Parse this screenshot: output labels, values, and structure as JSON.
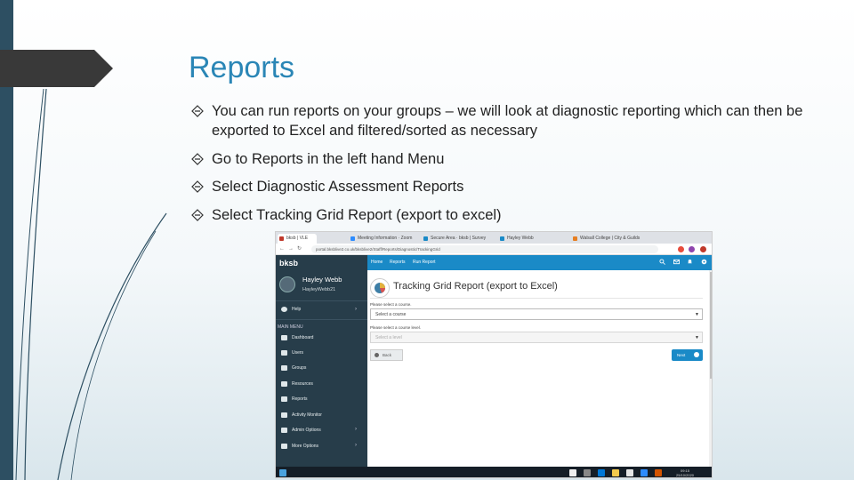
{
  "slide": {
    "title": "Reports",
    "bullets": [
      "You can run reports on your groups – we will look at diagnostic reporting which can then be exported to Excel and filtered/sorted as necessary",
      "Go to Reports in the left hand Menu",
      "Select Diagnostic Assessment Reports",
      "Select Tracking Grid Report (export to excel)"
    ],
    "colors": {
      "title": "#2a86b6",
      "left_bar": "#2d4f62",
      "title_tab": "#393939"
    }
  },
  "browser": {
    "tabs": [
      "bksb | VLE",
      "Meeting Information · Zoom",
      "Secure Area · bksb | Survey",
      "Hayley Webb",
      "Walsall College | City & Guilds"
    ],
    "url": "portal.bksblive2.co.uk/bksblive2/Staff/Reports/Diagnostic/TrackingGrid",
    "nav_icons": [
      "back-icon",
      "forward-icon",
      "reload-icon"
    ]
  },
  "app": {
    "brand": "bksb",
    "user_name": "Hayley Webb",
    "user_id": "HayleyWebb21",
    "help_label": "Help",
    "menu_heading": "MAIN MENU",
    "menu_items": [
      "Dashboard",
      "Users",
      "Groups",
      "Resources",
      "Reports",
      "Activity Monitor",
      "Admin Options",
      "More Options"
    ],
    "topbar_links": [
      "Home",
      "Reports",
      "Run Report"
    ],
    "topbar_icons": [
      "search-icon",
      "mail-icon",
      "bell-icon",
      "settings-icon"
    ],
    "accent": "#1a8ac7",
    "sidebar_color": "#273d4a"
  },
  "report_page": {
    "heading": "Tracking Grid Report (export to Excel)",
    "course_label": "Please select a course.",
    "course_value": "Select a course",
    "level_label": "Please select a course level.",
    "level_value": "Select a level",
    "back_label": "Back",
    "next_label": "Next"
  },
  "taskbar": {
    "time": "09:15",
    "date": "25/10/2020"
  }
}
